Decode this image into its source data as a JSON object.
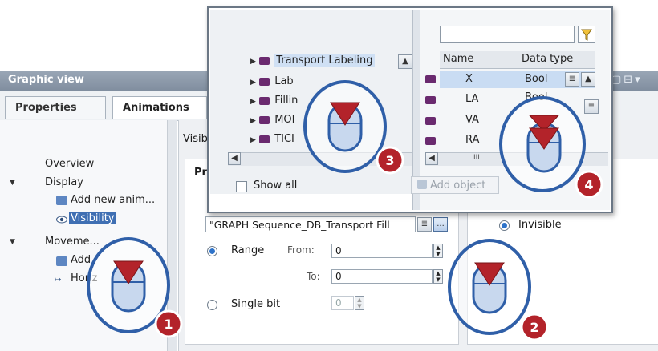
{
  "window": {
    "title": "Graphic view"
  },
  "tabs": [
    {
      "label": "Properties"
    },
    {
      "label": "Animations"
    }
  ],
  "tree": {
    "overview": "Overview",
    "display": "Display",
    "add_new_animation": "Add new anim...",
    "visibility": "Visibility",
    "movements": "Moveme...",
    "add_movement": "Add",
    "horizontal": "Horiz"
  },
  "main": {
    "visibility_heading": "Visib",
    "process_label": "Pr",
    "tag_value": "\"GRAPH Sequence_DB_Transport Fill",
    "range_label": "Range",
    "from_label": "From:",
    "from_value": "0",
    "to_label": "To:",
    "to_value": "0",
    "single_bit_label": "Single bit",
    "single_bit_value": "0",
    "invisible_label": "Invisible"
  },
  "popup": {
    "tree_items": [
      {
        "label": "Transport Labeling"
      },
      {
        "label": "Lab"
      },
      {
        "label": "Fillin"
      },
      {
        "label": "MOI"
      },
      {
        "label": "TICI"
      }
    ],
    "show_all_label": "Show all",
    "add_object_label": "Add object",
    "filter_value": "",
    "columns": [
      "Name",
      "Data type"
    ],
    "rows": [
      {
        "name": "X",
        "type": "Bool"
      },
      {
        "name": "LA",
        "type": "Bool"
      },
      {
        "name": "VA",
        "type": ""
      },
      {
        "name": "RA",
        "type": ""
      }
    ]
  },
  "callouts": [
    {
      "number": "1"
    },
    {
      "number": "2"
    },
    {
      "number": "3"
    },
    {
      "number": "4"
    }
  ],
  "colors": {
    "header": "#8895a5",
    "selection": "#3f6fb3",
    "accent_red": "#b3232a",
    "badge": "#b3232a"
  }
}
